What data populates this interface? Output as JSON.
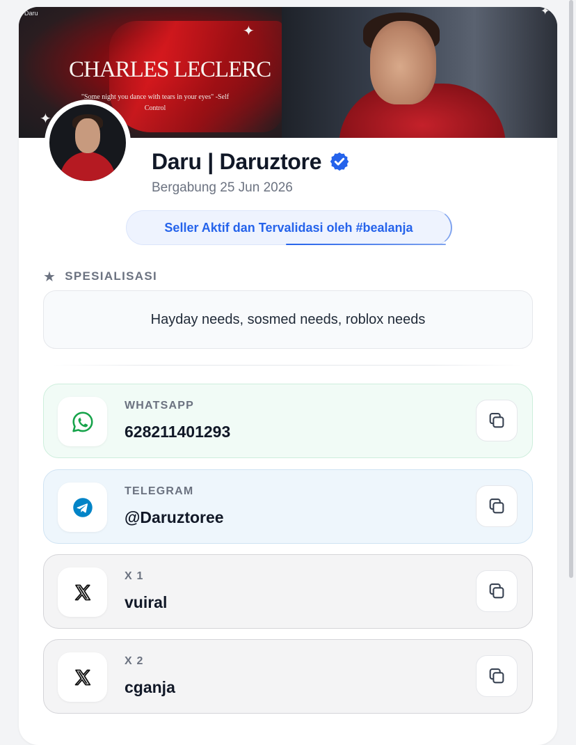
{
  "banner": {
    "tag": "Daru",
    "title": "CHARLES LECLERC",
    "quote": "\"Some night you dance with tears in your eyes\" -Self Control"
  },
  "profile": {
    "name": "Daru | Daruztore",
    "joined": "Bergabung 25 Jun 2026",
    "badge": "Seller Aktif dan Tervalidasi oleh #bealanja",
    "accent": "#2563eb"
  },
  "specialization": {
    "label": "SPESIALISASI",
    "text": "Hayday needs, sosmed needs, roblox needs"
  },
  "contacts": [
    {
      "label": "WHATSAPP",
      "value": "628211401293",
      "icon": "whatsapp-icon",
      "color": "#16a34a"
    },
    {
      "label": "TELEGRAM",
      "value": "@Daruztoree",
      "icon": "telegram-icon",
      "color": "#0284c7"
    },
    {
      "label": "X 1",
      "value": "vuiral",
      "icon": "x-logo-icon",
      "color": "#111111"
    },
    {
      "label": "X 2",
      "value": "cganja",
      "icon": "x-logo-icon",
      "color": "#111111"
    }
  ]
}
